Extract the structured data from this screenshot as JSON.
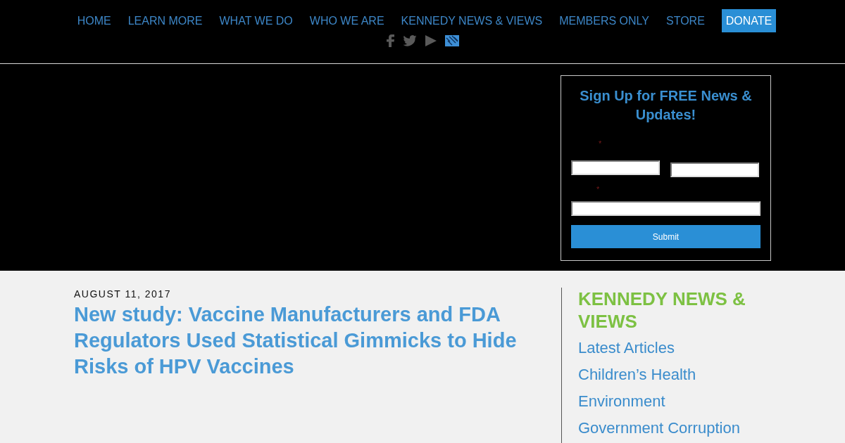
{
  "nav": {
    "items": [
      {
        "label": "HOME",
        "kind": "link"
      },
      {
        "label": "LEARN MORE",
        "kind": "link"
      },
      {
        "label": "WHAT WE DO",
        "kind": "link"
      },
      {
        "label": "WHO WE ARE",
        "kind": "link"
      },
      {
        "label": "KENNEDY NEWS & VIEWS",
        "kind": "link"
      },
      {
        "label": "MEMBERS ONLY",
        "kind": "link"
      },
      {
        "label": "STORE",
        "kind": "link"
      },
      {
        "label": "DONATE",
        "kind": "button"
      }
    ]
  },
  "signup": {
    "title": "Sign Up for FREE News & Updates!",
    "fields": [
      {
        "kind": "name",
        "required_mark": "*"
      },
      {
        "kind": "email",
        "required_mark": "*"
      }
    ],
    "submit": "Submit"
  },
  "article": {
    "date": "AUGUST 11, 2017",
    "title": "New study: Vaccine Manufacturers and FDA Regulators Used Statistical Gimmicks to Hide Risks of HPV Vaccines"
  },
  "sidebar": {
    "heading": "KENNEDY NEWS & VIEWS",
    "links": [
      "Latest Articles",
      "Children’s Health",
      "Environment",
      "Government Corruption"
    ]
  }
}
